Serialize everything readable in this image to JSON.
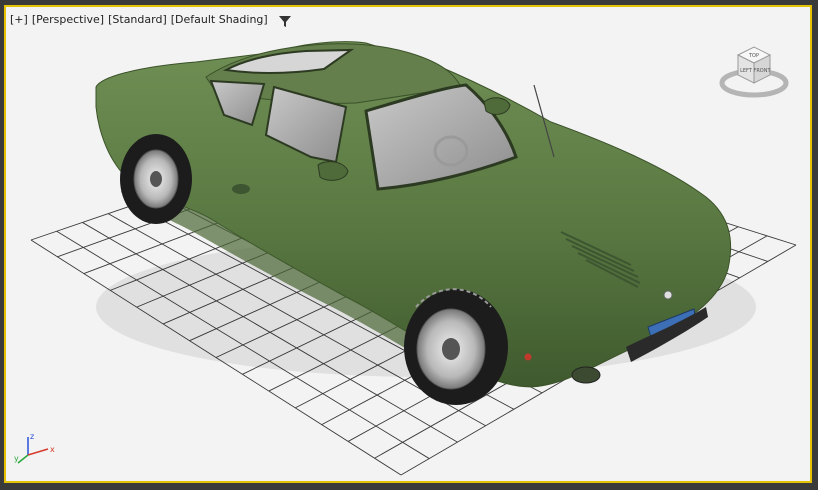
{
  "viewport": {
    "labels": [
      "[+]",
      "[Perspective]",
      "[Standard]",
      "[Default Shading]"
    ],
    "filter_icon": "filter-icon",
    "active_border_color": "#e6c300",
    "background_color": "#f3f3f3"
  },
  "scene": {
    "object": "sports-car",
    "body_color": "#5b7a43",
    "grid_color": "#3a3a3a"
  },
  "viewcube": {
    "faces": [
      "TOP",
      "FRONT",
      "LEFT"
    ]
  },
  "axis_tripod": {
    "x_label": "x",
    "y_label": "y",
    "z_label": "z"
  }
}
